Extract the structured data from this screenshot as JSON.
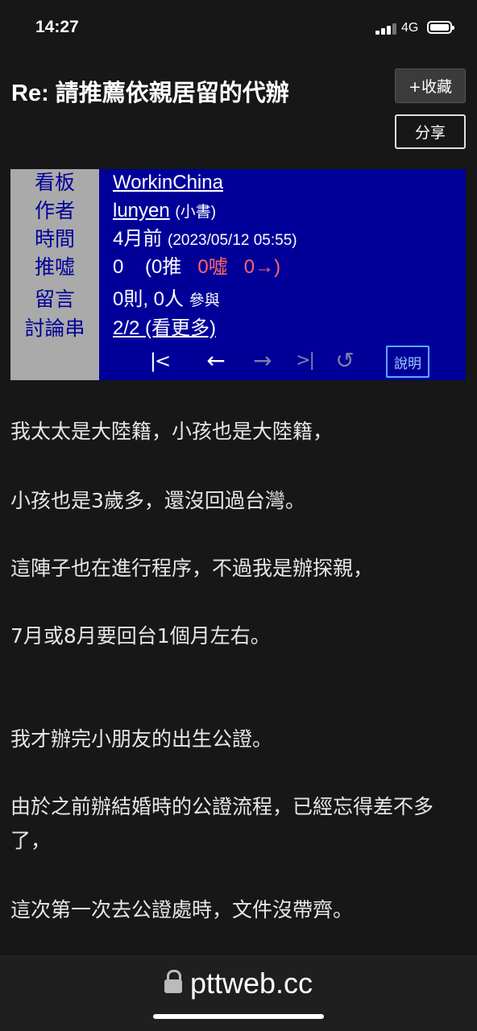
{
  "status_bar": {
    "time": "14:27",
    "network": "4G"
  },
  "header": {
    "title": "Re: 請推薦依親居留的代辦",
    "fav_button": "+收藏",
    "share_button": "分享"
  },
  "info": {
    "labels": {
      "board": "看板",
      "author": "作者",
      "time": "時間",
      "push": "推噓",
      "comments": "留言",
      "thread": "討論串"
    },
    "board": "WorkinChina",
    "author_id": "lunyen",
    "author_nick": "(小書)",
    "time_relative": "4月前",
    "time_exact": "(2023/05/12 05:55)",
    "push_score": "0",
    "push_open": "(0推",
    "boo": "0噓",
    "arrow": "0→)",
    "comments_count": "0則, 0人",
    "comments_suffix": "參與",
    "thread": "2/2 (看更多)",
    "nav": {
      "first": "|<",
      "prev": "←",
      "next": "→",
      "last": ">|",
      "reply": "↺",
      "help": "說明"
    }
  },
  "content": {
    "paragraphs": [
      "我太太是大陸籍，小孩也是大陸籍，",
      "小孩也是3歲多，還沒回過台灣。",
      "這陣子也在進行程序，不過我是辦探親，",
      "7月或8月要回台1個月左右。",
      "我才辦完小朋友的出生公證。",
      "由於之前辦結婚時的公證流程，已經忘得差不多了，",
      "這次第一次去公證處時，文件沒帶齊。"
    ]
  },
  "browser": {
    "url": "pttweb.cc"
  }
}
